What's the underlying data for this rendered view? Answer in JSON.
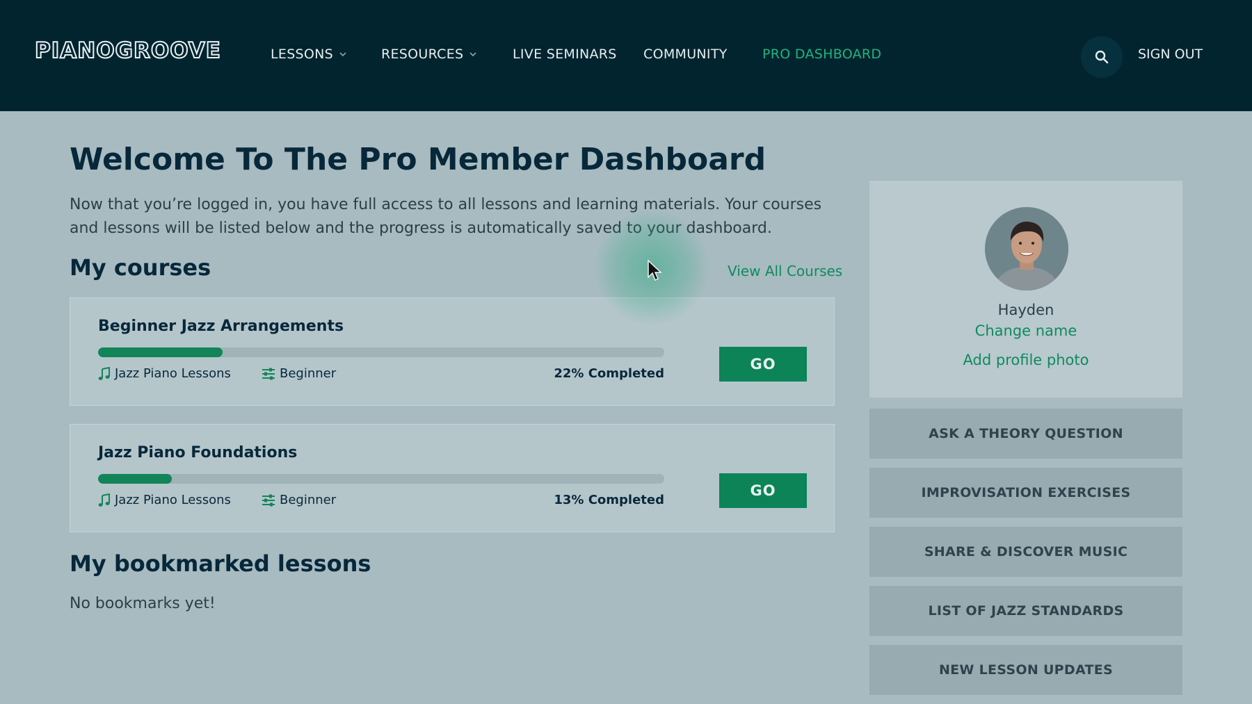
{
  "header": {
    "logo_text": "PIANOGROOVE",
    "nav": [
      {
        "label": "LESSONS",
        "dropdown": true
      },
      {
        "label": "RESOURCES",
        "dropdown": true
      },
      {
        "label": "LIVE SEMINARS",
        "dropdown": false
      },
      {
        "label": "COMMUNITY",
        "dropdown": false
      },
      {
        "label": "PRO DASHBOARD",
        "dropdown": false,
        "active": true
      }
    ],
    "search_icon": "search-icon",
    "sign_out": "SIGN OUT"
  },
  "main": {
    "title": "Welcome To The Pro Member Dashboard",
    "intro": "Now that you’re logged in, you have full access to all lessons and learning materials. Your courses and lessons will be listed below and the progress is automatically saved to your dashboard.",
    "my_courses_title": "My courses",
    "view_all": "View All Courses",
    "courses": [
      {
        "title": "Beginner Jazz Arrangements",
        "progress_percent": 22,
        "category": "Jazz Piano Lessons",
        "level": "Beginner",
        "completed_label": "22% Completed",
        "go_label": "GO"
      },
      {
        "title": "Jazz Piano Foundations",
        "progress_percent": 13,
        "category": "Jazz Piano Lessons",
        "level": "Beginner",
        "completed_label": "13% Completed",
        "go_label": "GO"
      }
    ],
    "bookmarks_title": "My bookmarked lessons",
    "no_bookmarks": "No bookmarks yet!"
  },
  "sidebar": {
    "profile": {
      "name": "Hayden",
      "change_name": "Change name",
      "add_photo": "Add profile photo"
    },
    "buttons": [
      "ASK A THEORY QUESTION",
      "IMPROVISATION EXERCISES",
      "SHARE & DISCOVER MUSIC",
      "LIST OF JAZZ STANDARDS",
      "NEW LESSON UPDATES"
    ]
  },
  "colors": {
    "header_bg": "#02242f",
    "accent_green": "#0c8458",
    "page_bg": "#a8bbc1"
  }
}
